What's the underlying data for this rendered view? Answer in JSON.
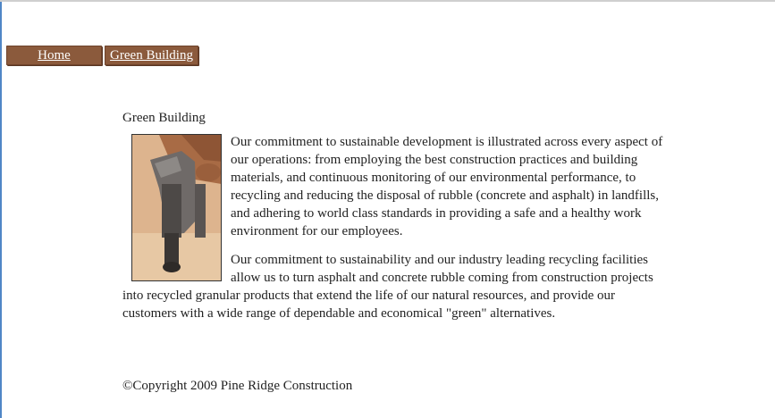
{
  "nav": {
    "items": [
      {
        "label": "Home"
      },
      {
        "label": "Green Building"
      }
    ]
  },
  "content": {
    "title": "Green Building",
    "paragraphs": [
      "Our commitment to sustainable development is illustrated across every aspect of our operations: from employing the best construction practices and building materials, and continuous monitoring of our environmental performance, to recycling and reducing the disposal of rubble (concrete and asphalt) in landfills, and adhering to world class standards in providing a safe and a healthy work environment for our employees.",
      "Our commitment to sustainability and our industry leading recycling facilities allow us to turn asphalt and concrete rubble coming from construction projects into recycled granular products that extend the life of our natural resources, and provide our customers with a wide range of dependable and economical \"green\" alternatives."
    ]
  },
  "footer": {
    "copyright": "©Copyright 2009 Pine Ridge Construction"
  },
  "colors": {
    "tab_bg": "#8b5a3c",
    "tab_text": "#ffffff"
  },
  "icons": {
    "photo": "nail-gun-photo"
  }
}
